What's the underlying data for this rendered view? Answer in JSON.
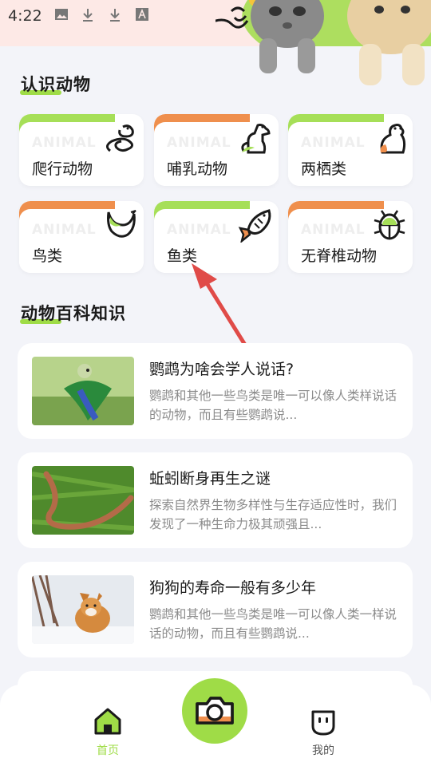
{
  "status_bar": {
    "time": "4:22"
  },
  "sections": {
    "know_animals": "认识动物",
    "encyclopedia": "动物百科知识"
  },
  "categories": [
    {
      "label": "爬行动物",
      "watermark": "ANIMAL",
      "icon": "snake-icon",
      "color": "#a6df58"
    },
    {
      "label": "哺乳动物",
      "watermark": "ANIMAL",
      "icon": "dog-icon",
      "color": "#ef8f4d"
    },
    {
      "label": "两栖类",
      "watermark": "ANIMAL",
      "icon": "frog-icon",
      "color": "#a6df58"
    },
    {
      "label": "鸟类",
      "watermark": "ANIMAL",
      "icon": "bird-icon",
      "color": "#ef8f4d"
    },
    {
      "label": "鱼类",
      "watermark": "ANIMAL",
      "icon": "fish-icon",
      "color": "#a6df58"
    },
    {
      "label": "无脊椎动物",
      "watermark": "ANIMAL",
      "icon": "beetle-icon",
      "color": "#ef8f4d"
    }
  ],
  "articles": [
    {
      "title": "鹦鹉为啥会学人说话?",
      "desc": "鹦鹉和其他一些鸟类是唯一可以像人类样说话的动物，而且有些鹦鹉说..."
    },
    {
      "title": "蚯蚓断身再生之谜",
      "desc": "探索自然界生物多样性与生存适应性时，我们发现了一种生命力极其顽强且..."
    },
    {
      "title": "狗狗的寿命一般有多少年",
      "desc": "鹦鹉和其他一些鸟类是唯一可以像人类一样说话的动物，而且有些鹦鹉说..."
    }
  ],
  "nav": {
    "home": "首页",
    "mine": "我的",
    "active_color": "#9fdc47"
  }
}
